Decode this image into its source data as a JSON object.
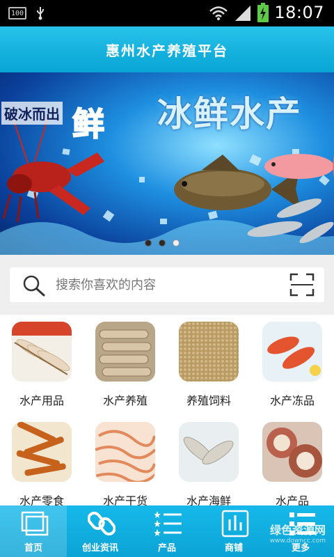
{
  "status_bar": {
    "battery_level": "100",
    "time": "18:07",
    "icons": [
      "usb-icon",
      "wifi-icon",
      "signal-icon",
      "battery-charging-icon"
    ]
  },
  "header": {
    "title": "惠州水产养殖平台"
  },
  "banner": {
    "slogan": "破冰而出",
    "feature_char": "鲜",
    "headline": "冰鲜水产",
    "slide_count": 3,
    "active_slide": 3
  },
  "search": {
    "placeholder": "搜索你喜欢的内容",
    "icons": [
      "search-icon",
      "scan-icon"
    ]
  },
  "categories": [
    {
      "label": "水产用品",
      "icon": "shrimp-skewer-image"
    },
    {
      "label": "水产养殖",
      "icon": "mantis-shrimp-image"
    },
    {
      "label": "养殖饲料",
      "icon": "feed-pellets-image"
    },
    {
      "label": "水产冻品",
      "icon": "frozen-shrimp-image"
    },
    {
      "label": "水产零食",
      "icon": "dried-fish-snack-image"
    },
    {
      "label": "水产干货",
      "icon": "dried-squid-image"
    },
    {
      "label": "水产海鲜",
      "icon": "prawns-image"
    },
    {
      "label": "水产品",
      "icon": "scallops-image"
    }
  ],
  "bottom_nav": {
    "items": [
      {
        "label": "首页",
        "icon": "home-icon",
        "active": true
      },
      {
        "label": "创业资讯",
        "icon": "link-icon",
        "active": false
      },
      {
        "label": "产品",
        "icon": "star-list-icon",
        "active": false
      },
      {
        "label": "商铺",
        "icon": "shop-chart-icon",
        "active": false
      },
      {
        "label": "更多",
        "icon": "more-list-icon",
        "active": false
      }
    ]
  },
  "watermark": {
    "text": "绿色资源网",
    "url": "www.downcc.com"
  },
  "colors": {
    "header": "#08a4d4",
    "nav": "#0ca3d6",
    "search_bg": "#efefef"
  }
}
